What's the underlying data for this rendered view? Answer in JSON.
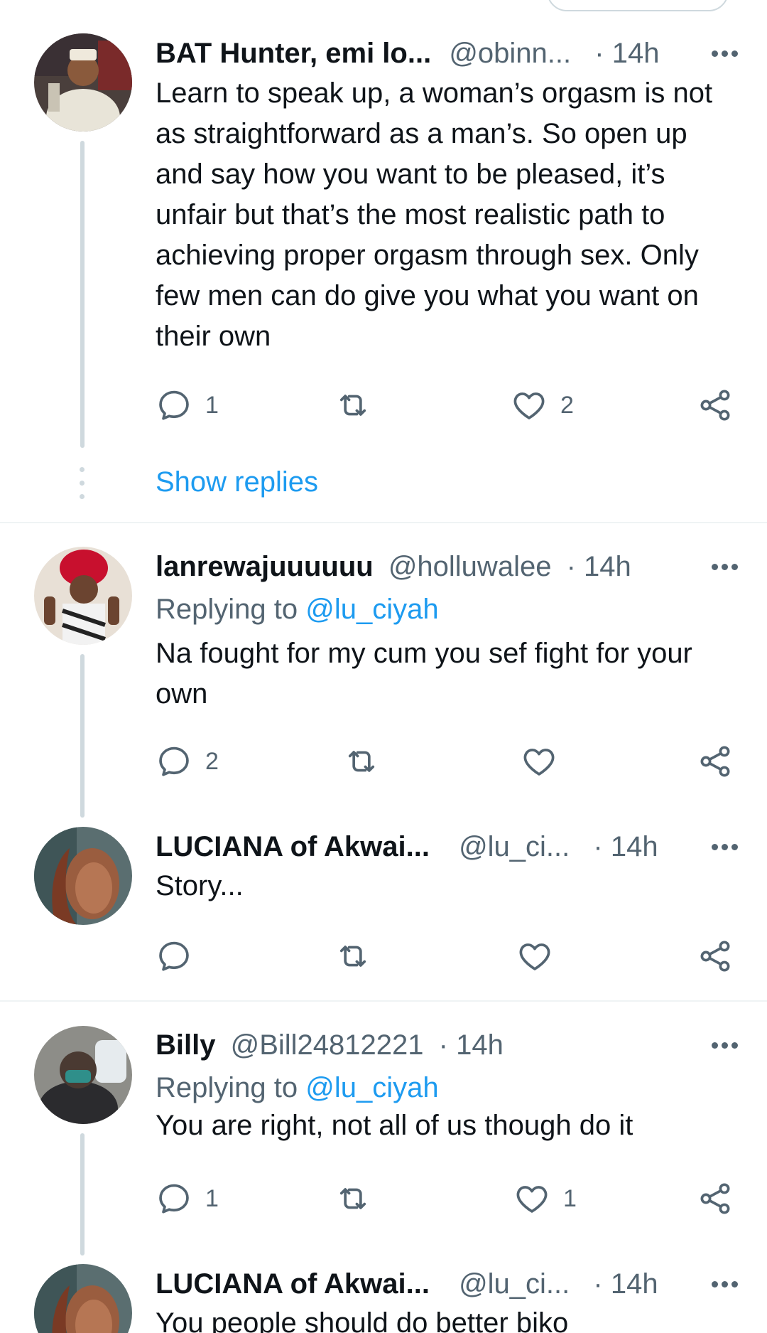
{
  "tweets": [
    {
      "name": "BAT Hunter, emi lo...",
      "handle": "@obinn...",
      "dot": "·",
      "time": "14h",
      "replying_prefix": "",
      "replying_mention": "",
      "text": "Learn to speak up, a woman’s orgasm is not as straightforward as a man’s. So open up and say how you want to be pleased, it’s unfair but that’s the most realistic path to achieving proper orgasm through sex. Only few men can do give you what you want on their own",
      "reply_count": "1",
      "retweet_count": "",
      "like_count": "2"
    },
    {
      "name": "lanrewajuuuuuu",
      "handle": "@holluwalee",
      "dot": "·",
      "time": "14h",
      "replying_prefix": "Replying to ",
      "replying_mention": "@lu_ciyah",
      "text": "Na fought for my cum you sef fight for your own",
      "reply_count": "2",
      "retweet_count": "",
      "like_count": ""
    },
    {
      "name": "LUCIANA of Akwai...",
      "handle": "@lu_ci...",
      "dot": "·",
      "time": "14h",
      "replying_prefix": "",
      "replying_mention": "",
      "text": "Story...",
      "reply_count": "",
      "retweet_count": "",
      "like_count": ""
    },
    {
      "name": "Billy",
      "handle": "@Bill24812221",
      "dot": "·",
      "time": "14h",
      "replying_prefix": "Replying to ",
      "replying_mention": "@lu_ciyah",
      "text": "You are right, not all of us though do it",
      "reply_count": "1",
      "retweet_count": "",
      "like_count": "1"
    },
    {
      "name": "LUCIANA of Akwai...",
      "handle": "@lu_ci...",
      "dot": "·",
      "time": "14h",
      "replying_prefix": "",
      "replying_mention": "",
      "text": "You people should do better biko",
      "reply_count": "",
      "retweet_count": "",
      "like_count": ""
    }
  ],
  "show_replies_label": "Show replies",
  "icons": {
    "reply": "reply-icon",
    "retweet": "retweet-icon",
    "like": "heart-icon",
    "share": "share-icon",
    "more": "more-icon"
  },
  "colors": {
    "link": "#1d9bf0",
    "secondary": "#536471",
    "primary": "#0f1419",
    "thread_line": "#cfd9de"
  }
}
